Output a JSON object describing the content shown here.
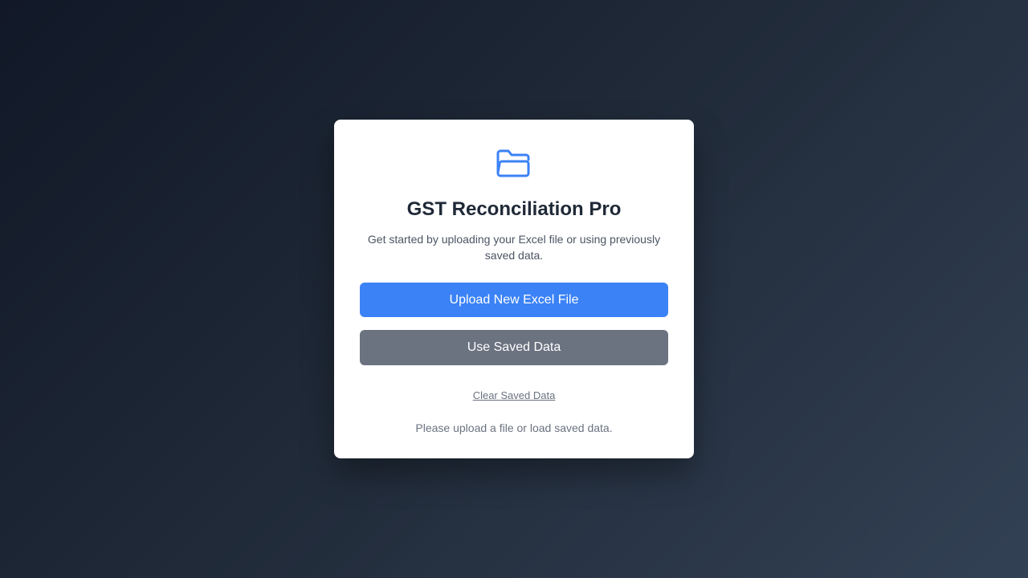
{
  "app": {
    "title": "GST Reconciliation Pro",
    "subtitle": "Get started by uploading your Excel file or using previously saved data."
  },
  "icon": {
    "name": "folder-open-icon",
    "color": "#3b82f6"
  },
  "actions": {
    "upload_label": "Upload New Excel File",
    "use_saved_label": "Use Saved Data",
    "clear_label": "Clear Saved Data"
  },
  "status": {
    "message": "Please upload a file or load saved data."
  },
  "colors": {
    "primary": "#3b82f6",
    "secondary": "#6b7280",
    "title": "#1f2937"
  }
}
